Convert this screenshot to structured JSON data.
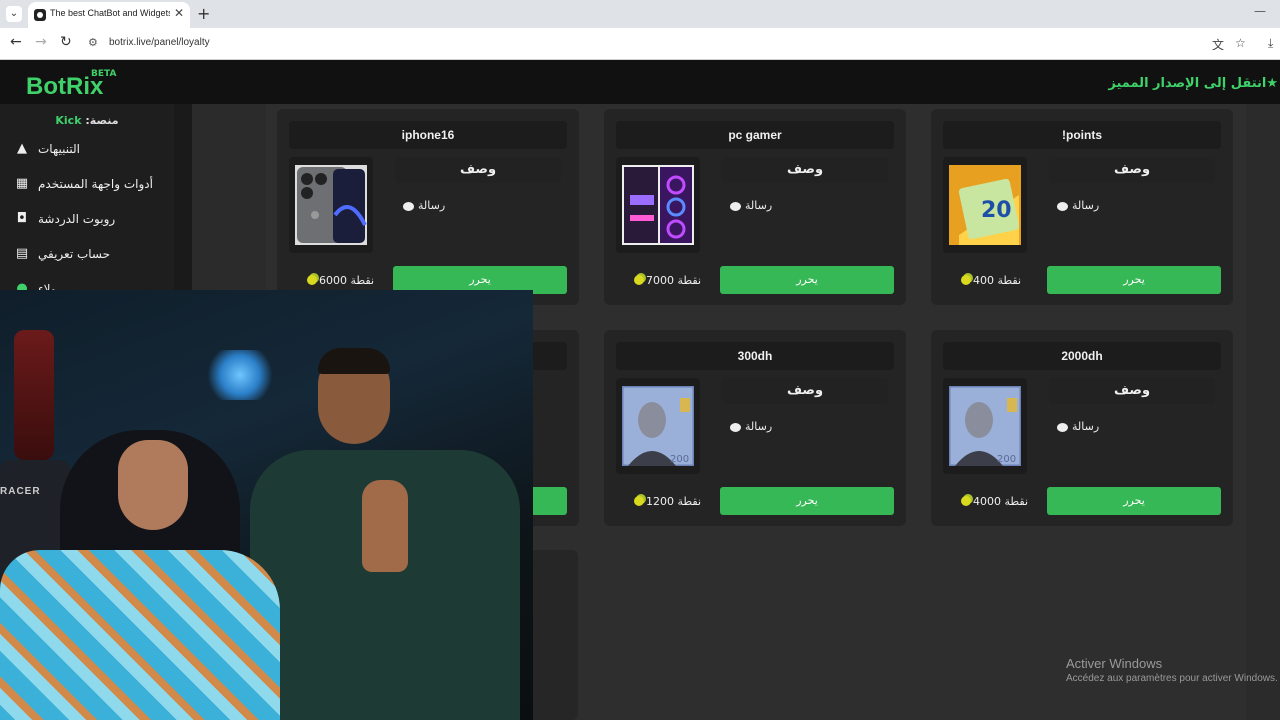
{
  "browser": {
    "tab_title": "The best ChatBot and Widgets",
    "url": "botrix.live/panel/loyalty",
    "tab_menu_icon": "chevron-down-icon",
    "new_tab_glyph": "+",
    "close_glyph": "✕",
    "minimize_glyph": "—",
    "back_glyph": "←",
    "forward_glyph": "→",
    "reload_glyph": "↻",
    "site_info_glyph": "⚙",
    "translate_glyph": "文",
    "star_glyph": "☆",
    "download_glyph": "⤓"
  },
  "header": {
    "logo": "BotRix",
    "beta": "BETA",
    "upgrade": "انتقل إلى الإصدار المميز",
    "upgrade_star": "★",
    "accent_color": "#3fd16a"
  },
  "sidebar": {
    "platform_prefix": "منصة:",
    "platform_name": "Kick",
    "items": [
      {
        "label": "التنبيهات",
        "icon": "warning-icon",
        "glyph": "▲"
      },
      {
        "label": "أدوات واجهة المستخدم",
        "icon": "grid-icon",
        "glyph": "▦"
      },
      {
        "label": "روبوت الدردشة",
        "icon": "robot-icon",
        "glyph": "◘"
      },
      {
        "label": "حساب تعريفي",
        "icon": "id-card-icon",
        "glyph": "▤"
      },
      {
        "label": "ولاء",
        "icon": "coins-icon",
        "glyph": "●"
      }
    ]
  },
  "rewards": {
    "common": {
      "description": "وصف",
      "message": "رسالة",
      "redeem": "يحرر",
      "points_unit": "نقطة"
    },
    "cards": [
      {
        "title": "iphone16",
        "points": "6000",
        "image": "iphone-image"
      },
      {
        "title": "pc gamer",
        "points": "7000",
        "image": "pc-image"
      },
      {
        "title": "!points",
        "points": "400",
        "image": "recharge-card-image"
      },
      {
        "title": "",
        "points": "",
        "image": "hidden"
      },
      {
        "title": "300dh",
        "points": "1200",
        "image": "banknote-image"
      },
      {
        "title": "2000dh",
        "points": "4000",
        "image": "banknote-image"
      }
    ]
  },
  "webcam": {
    "chair_text": "RACER"
  },
  "watermark": {
    "title": "Activer Windows",
    "subtitle": "Accédez aux paramètres pour activer Windows."
  }
}
